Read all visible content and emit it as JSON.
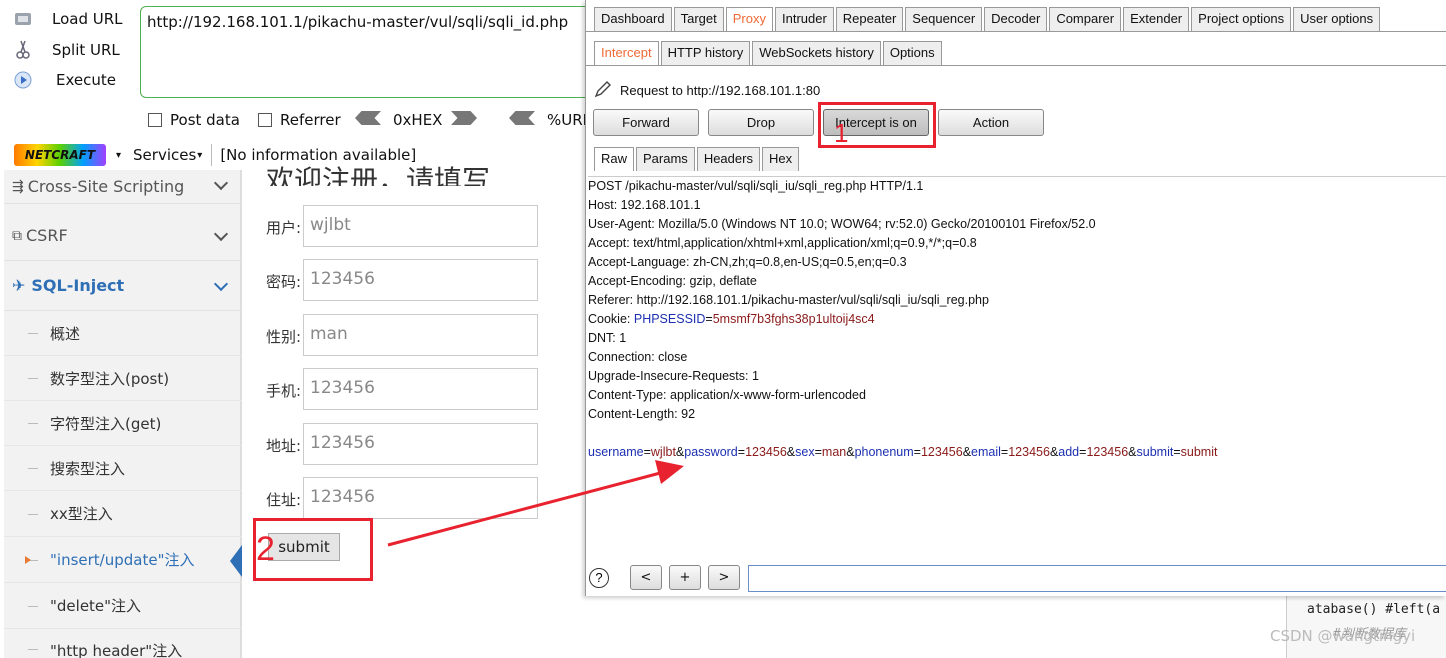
{
  "hackbar": {
    "load_url": "Load URL",
    "split_url": "Split URL",
    "execute": "Execute",
    "url_value": "http://192.168.101.1/pikachu-master/vul/sqli/sqli_id.php",
    "post_data": "Post data",
    "referrer": "Referrer",
    "hex": "0xHEX",
    "urlenc": "%URL"
  },
  "netcraft": {
    "logo": "NETCRAFT",
    "services": "Services",
    "info": "[No information available]"
  },
  "sidebar": {
    "xss": "Cross-Site Scripting",
    "csrf": "CSRF",
    "sqli": "SQL-Inject",
    "subs": [
      "概述",
      "数字型注入(post)",
      "字符型注入(get)",
      "搜索型注入",
      "xx型注入",
      "\"insert/update\"注入",
      "\"delete\"注入",
      "\"http header\"注入"
    ]
  },
  "form": {
    "heading": "欢迎注册，请填写",
    "fields": [
      {
        "label": "用户:",
        "value": "wjlbt"
      },
      {
        "label": "密码:",
        "value": "123456"
      },
      {
        "label": "性别:",
        "value": "man"
      },
      {
        "label": "手机:",
        "value": "123456"
      },
      {
        "label": "地址:",
        "value": "123456"
      },
      {
        "label": "住址:",
        "value": "123456"
      }
    ],
    "submit": "submit"
  },
  "burp": {
    "main_tabs": [
      "Dashboard",
      "Target",
      "Proxy",
      "Intruder",
      "Repeater",
      "Sequencer",
      "Decoder",
      "Comparer",
      "Extender",
      "Project options",
      "User options"
    ],
    "sub_tabs": [
      "Intercept",
      "HTTP history",
      "WebSockets history",
      "Options"
    ],
    "request_to": "Request to http://192.168.101.1:80",
    "buttons": {
      "forward": "Forward",
      "drop": "Drop",
      "intercept": "Intercept is on",
      "action": "Action"
    },
    "view_tabs": [
      "Raw",
      "Params",
      "Headers",
      "Hex"
    ],
    "request_lines": [
      "POST /pikachu-master/vul/sqli/sqli_iu/sqli_reg.php HTTP/1.1",
      "Host: 192.168.101.1",
      "User-Agent: Mozilla/5.0 (Windows NT 10.0; WOW64; rv:52.0) Gecko/20100101 Firefox/52.0",
      "Accept: text/html,application/xhtml+xml,application/xml;q=0.9,*/*;q=0.8",
      "Accept-Language: zh-CN,zh;q=0.8,en-US;q=0.5,en;q=0.3",
      "Accept-Encoding: gzip, deflate",
      "Referer: http://192.168.101.1/pikachu-master/vul/sqli/sqli_iu/sqli_reg.php"
    ],
    "cookie_label": "Cookie: ",
    "cookie_key": "PHPSESSID",
    "cookie_val": "5msmf7b3fghs38p1ultoij4sc4",
    "request_lines2": [
      "DNT: 1",
      "Connection: close",
      "Upgrade-Insecure-Requests: 1",
      "Content-Type: application/x-www-form-urlencoded",
      "Content-Length: 92"
    ],
    "body_params": [
      {
        "k": "username",
        "v": "wjlbt"
      },
      {
        "k": "password",
        "v": "123456"
      },
      {
        "k": "sex",
        "v": "man"
      },
      {
        "k": "phonenum",
        "v": "123456"
      },
      {
        "k": "email",
        "v": "123456"
      },
      {
        "k": "add",
        "v": "123456"
      },
      {
        "k": "submit",
        "v": "submit"
      }
    ],
    "nav": {
      "help": "?",
      "prev": "<",
      "plus": "+",
      "next": ">"
    }
  },
  "annotations": {
    "one": "1",
    "two": "2"
  },
  "bg_code": {
    "line1": "atabase() #left(a",
    "line2": "#判断数据库"
  },
  "watermark": "CSDN @wangtingyi",
  "colors": {
    "accent": "#f06a35",
    "annotation": "#e8232f"
  }
}
